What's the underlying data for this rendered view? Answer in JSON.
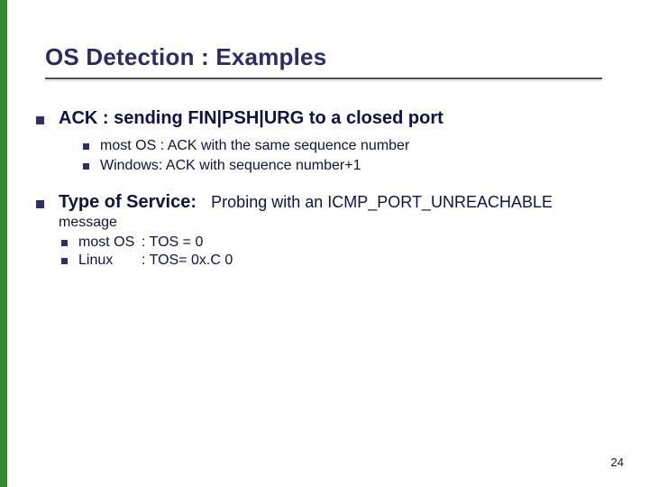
{
  "slide": {
    "title": "OS Detection : Examples",
    "page_number": "24"
  },
  "bullets": {
    "b1": {
      "heading": "ACK : sending FIN|PSH|URG to a closed port",
      "sub1": "most OS : ACK with the same sequence number",
      "sub2": "Windows: ACK with sequence number+1"
    },
    "b2": {
      "heading_bold": "Type of Service:",
      "heading_rest": "Probing with an ICMP_PORT_UNREACHABLE",
      "cont": "message",
      "sub1_key": "most OS",
      "sub1_val": ": TOS = 0",
      "sub2_key": "Linux",
      "sub2_val": ": TOS= 0x.C 0"
    }
  },
  "chart_data": {
    "type": "table",
    "title": "OS Detection : Examples",
    "rows": [
      {
        "probe": "ACK (FIN|PSH|URG to closed port)",
        "os": "most OS",
        "response": "ACK with the same sequence number"
      },
      {
        "probe": "ACK (FIN|PSH|URG to closed port)",
        "os": "Windows",
        "response": "ACK with sequence number+1"
      },
      {
        "probe": "Type of Service (ICMP_PORT_UNREACHABLE)",
        "os": "most OS",
        "response": "TOS = 0"
      },
      {
        "probe": "Type of Service (ICMP_PORT_UNREACHABLE)",
        "os": "Linux",
        "response": "TOS = 0xC0"
      }
    ]
  }
}
